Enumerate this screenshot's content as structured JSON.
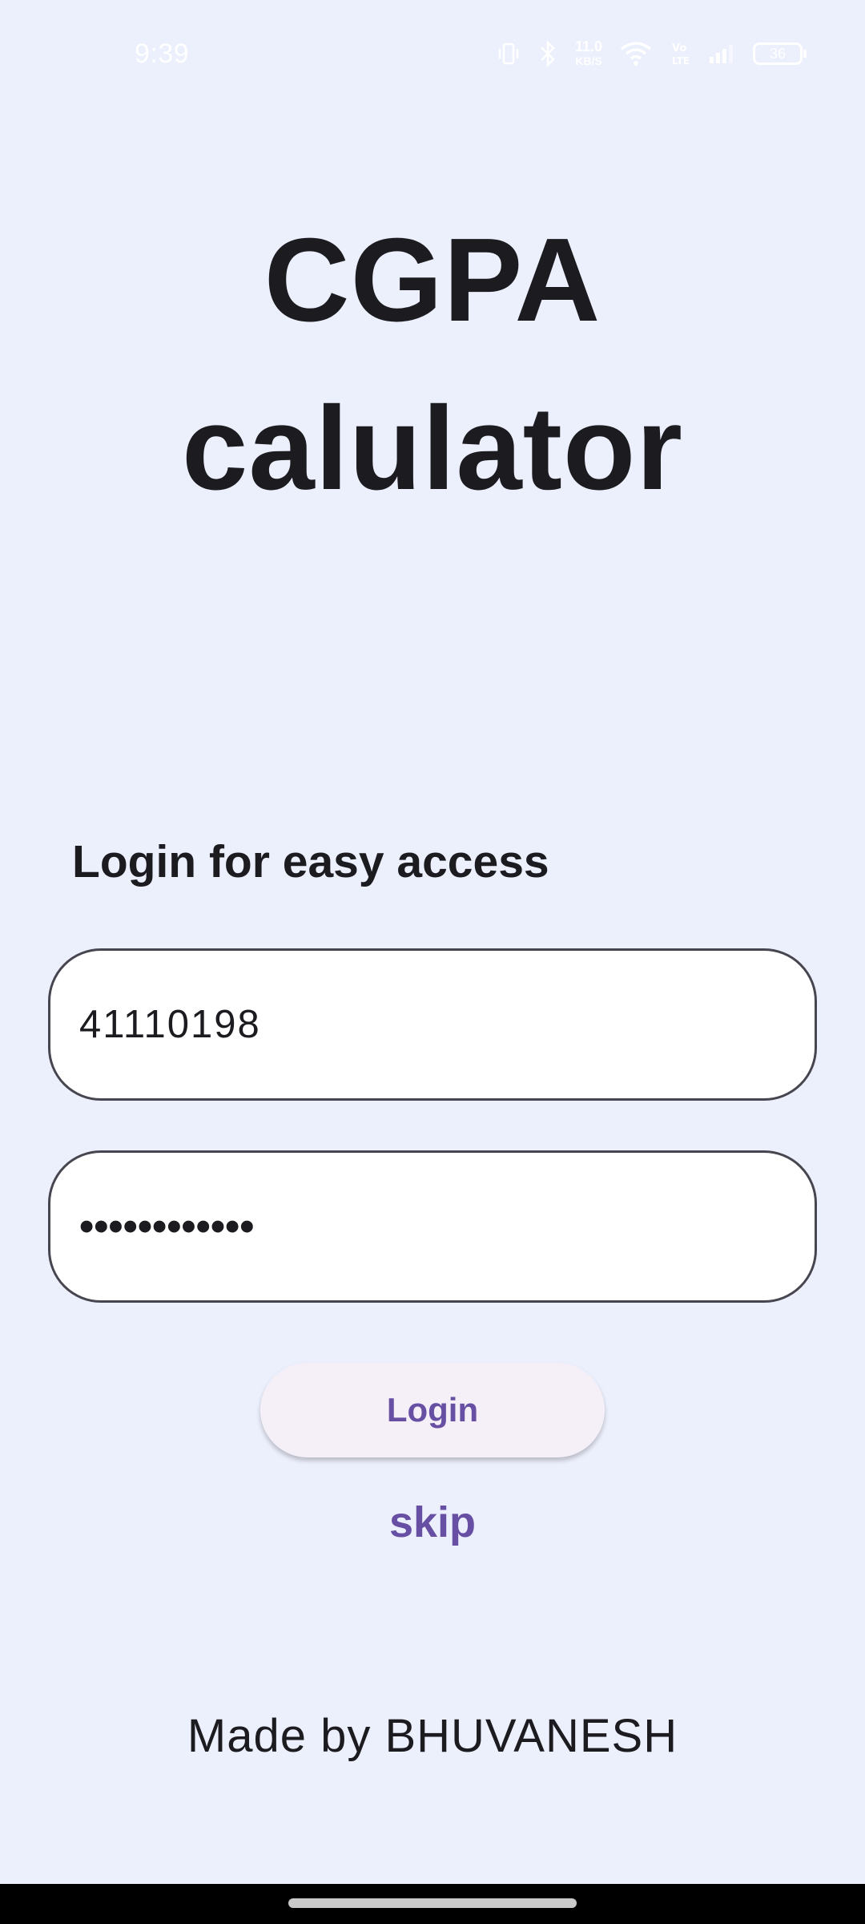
{
  "status_bar": {
    "time": "9:39",
    "net_speed_value": "11.0",
    "net_speed_unit": "KB/S",
    "battery_level": "36",
    "icons": [
      "vibrate-icon",
      "bluetooth-icon",
      "wifi-icon",
      "volte-icon",
      "signal-icon",
      "battery-icon"
    ]
  },
  "title": {
    "line1": "CGPA",
    "line2": "calulator"
  },
  "login": {
    "heading": "Login for easy access",
    "username_value": "41110198",
    "password_value": "••••••••••••",
    "button_label": "Login",
    "skip_label": "skip"
  },
  "footer": {
    "credit": "Made by BHUVANESH"
  },
  "colors": {
    "background": "#ECEFFC",
    "primary": "#6750A4",
    "text": "#1B1B20",
    "field_border": "#47454F"
  }
}
